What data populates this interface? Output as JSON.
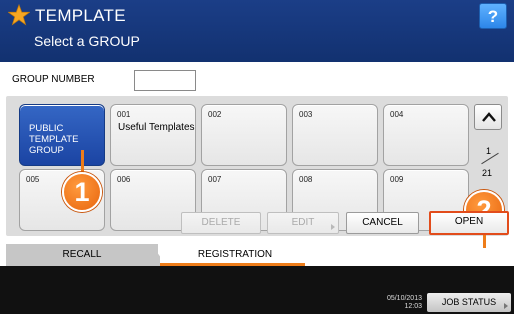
{
  "header": {
    "title": "TEMPLATE",
    "subtitle": "Select a GROUP",
    "help_label": "?",
    "star_color": "#f5a623"
  },
  "group_number": {
    "label": "GROUP NUMBER",
    "value": ""
  },
  "groups": [
    {
      "number": "",
      "name": "PUBLIC TEMPLATE GROUP"
    },
    {
      "number": "001",
      "name": "Useful Templates"
    },
    {
      "number": "002",
      "name": ""
    },
    {
      "number": "003",
      "name": ""
    },
    {
      "number": "004",
      "name": ""
    },
    {
      "number": "005",
      "name": ""
    },
    {
      "number": "006",
      "name": ""
    },
    {
      "number": "007",
      "name": ""
    },
    {
      "number": "008",
      "name": ""
    },
    {
      "number": "009",
      "name": ""
    }
  ],
  "pagination": {
    "current": "1",
    "total": "21"
  },
  "callouts": {
    "one": "1",
    "two": "2",
    "color": "#ee7d1a"
  },
  "actions": {
    "delete": "DELETE",
    "edit": "EDIT",
    "cancel": "CANCEL",
    "open": "OPEN"
  },
  "tabs": {
    "recall": "RECALL",
    "registration": "REGISTRATION"
  },
  "status": {
    "date": "05/10/2013",
    "time": "12:03",
    "job_status": "JOB STATUS"
  }
}
